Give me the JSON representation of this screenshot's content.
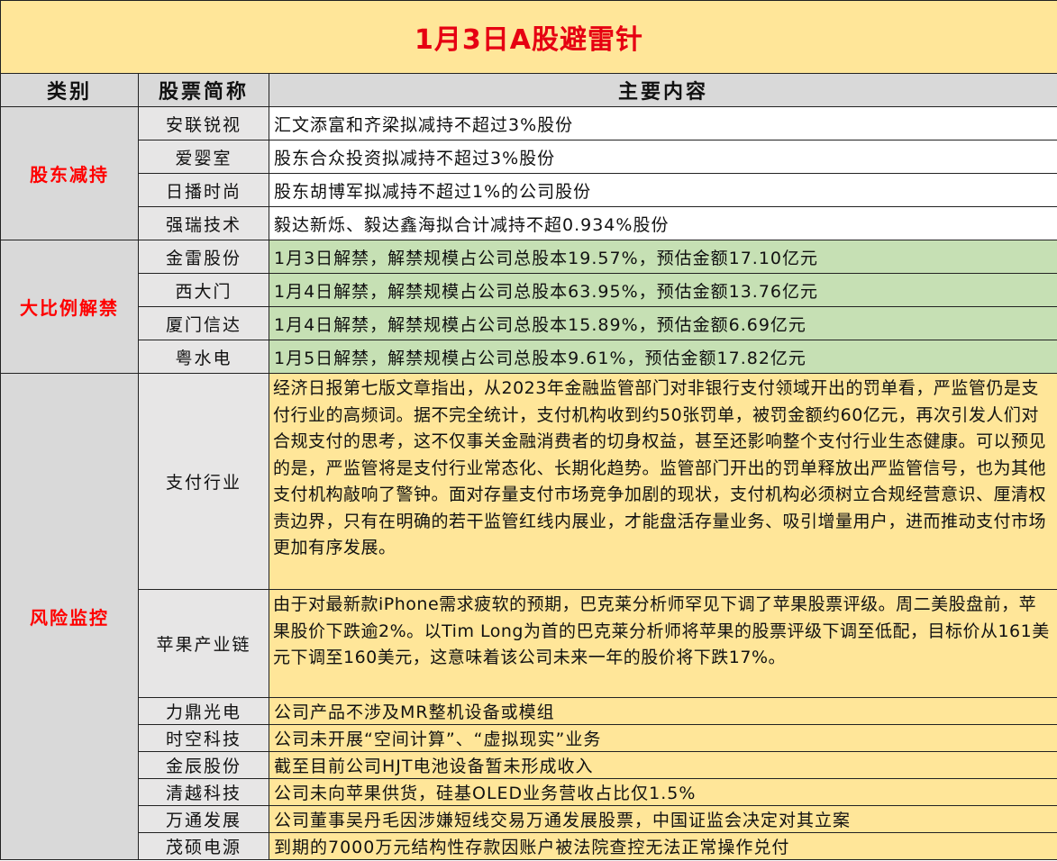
{
  "title": "1月3日A股避雷针",
  "headers": [
    "类别",
    "股票简称",
    "主要内容"
  ],
  "sections": [
    {
      "category": "股东减持",
      "rows": [
        {
          "name": "安联锐视",
          "content": "汇文添富和齐梁拟减持不超过3%股份"
        },
        {
          "name": "爱婴室",
          "content": "股东合众投资拟减持不超过3%股份"
        },
        {
          "name": "日播时尚",
          "content": "股东胡博军拟减持不超过1%的公司股份"
        },
        {
          "name": "强瑞技术",
          "content": "毅达新烁、毅达鑫海拟合计减持不超0.934%股份"
        }
      ]
    },
    {
      "category": "大比例解禁",
      "rows": [
        {
          "name": "金雷股份",
          "content": "1月3日解禁，解禁规模占公司总股本19.57%，预估金额17.10亿元"
        },
        {
          "name": "西大门",
          "content": "1月4日解禁，解禁规模占公司总股本63.95%，预估金额13.76亿元"
        },
        {
          "name": "厦门信达",
          "content": "1月4日解禁，解禁规模占公司总股本15.89%，预估金额6.69亿元"
        },
        {
          "name": "粤水电",
          "content": "1月5日解禁，解禁规模占公司总股本9.61%，预估金额17.82亿元"
        }
      ]
    },
    {
      "category": "风险监控",
      "rows": [
        {
          "name": "支付行业",
          "content": "经济日报第七版文章指出，从2023年金融监管部门对非银行支付领域开出的罚单看，严监管仍是支付行业的高频词。据不完全统计，支付机构收到约50张罚单，被罚金额约60亿元，再次引发人们对合规支付的思考，这不仅事关金融消费者的切身权益，甚至还影响整个支付行业生态健康。可以预见的是，严监管将是支付行业常态化、长期化趋势。监管部门开出的罚单释放出严监管信号，也为其他支付机构敲响了警钟。面对存量支付市场竞争加剧的现状，支付机构必须树立合规经营意识、厘清权责边界，只有在明确的若干监管红线内展业，才能盘活存量业务、吸引增量用户，进而推动支付市场更加有序发展。"
        },
        {
          "name": "苹果产业链",
          "content": "由于对最新款iPhone需求疲软的预期，巴克莱分析师罕见下调了苹果股票评级。周二美股盘前，苹果股价下跌逾2%。以Tim Long为首的巴克莱分析师将苹果的股票评级下调至低配，目标价从161美元下调至160美元，这意味着该公司未来一年的股价将下跌17%。"
        },
        {
          "name": "力鼎光电",
          "content": "公司产品不涉及MR整机设备或模组"
        },
        {
          "name": "时空科技",
          "content": "公司未开展“空间计算”、“虚拟现实”业务"
        },
        {
          "name": "金辰股份",
          "content": "截至目前公司HJT电池设备暂未形成收入"
        },
        {
          "name": "清越科技",
          "content": "公司未向苹果供货，硅基OLED业务营收占比仅1.5%"
        },
        {
          "name": "万通发展",
          "content": "公司董事吴丹毛因涉嫌短线交易万通发展股票，中国证监会决定对其立案"
        },
        {
          "name": "茂硕电源",
          "content": "到期的7000万元结构性存款因账户被法院查控无法正常操作兑付"
        }
      ]
    }
  ]
}
